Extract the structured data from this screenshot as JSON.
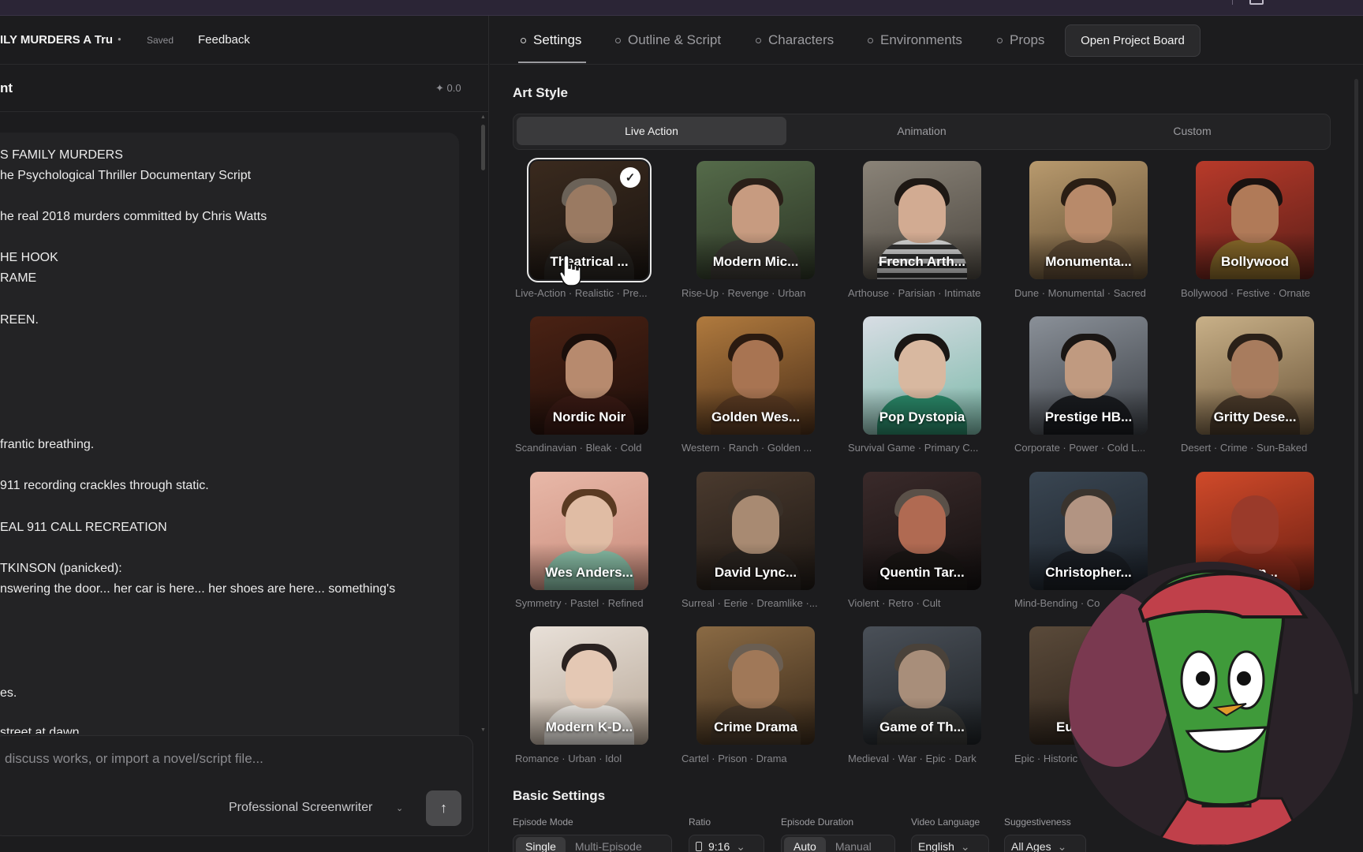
{
  "project": {
    "title": "ILY MURDERS A Tru",
    "save_status": "Saved",
    "feedback_label": "Feedback"
  },
  "document": {
    "title": "nt",
    "credits": "✦ 0.0",
    "lines": [
      "S FAMILY MURDERS",
      "he Psychological Thriller Documentary Script",
      "he real 2018 murders committed by Chris Watts",
      "HE HOOK",
      "RAME",
      "REEN.",
      "frantic breathing.",
      " 911 recording crackles through static.",
      "EAL 911 CALL RECREATION",
      "TKINSON (panicked):",
      "nswering the door... her car is here... her shoes are here... something's",
      "es.",
      " street at dawn"
    ]
  },
  "chat": {
    "placeholder": " discuss works, or import a novel/script file...",
    "persona": "Professional Screenwriter",
    "send_icon": "arrow-up-icon"
  },
  "tabs": [
    {
      "label": "Settings",
      "active": true
    },
    {
      "label": "Outline & Script",
      "active": false
    },
    {
      "label": "Characters",
      "active": false
    },
    {
      "label": "Environments",
      "active": false
    },
    {
      "label": "Props",
      "active": false
    }
  ],
  "open_board_label": "Open Project Board",
  "art_style": {
    "title": "Art Style",
    "segments": [
      "Live Action",
      "Animation",
      "Custom"
    ],
    "active_segment": "Live Action",
    "cards": [
      {
        "name": "Theatrical ...",
        "tags": "Live-Action · Realistic · Pre...",
        "selected": true
      },
      {
        "name": "Modern Mic...",
        "tags": "Rise-Up · Revenge · Urban"
      },
      {
        "name": "French Arth...",
        "tags": "Arthouse · Parisian · Intimate"
      },
      {
        "name": "Monumenta...",
        "tags": "Dune · Monumental · Sacred"
      },
      {
        "name": "Bollywood",
        "tags": "Bollywood · Festive · Ornate"
      },
      {
        "name": "Nordic Noir",
        "tags": "Scandinavian · Bleak · Cold"
      },
      {
        "name": "Golden Wes...",
        "tags": "Western · Ranch · Golden ..."
      },
      {
        "name": "Pop Dystopia",
        "tags": "Survival Game · Primary C..."
      },
      {
        "name": "Prestige HB...",
        "tags": "Corporate · Power · Cold L..."
      },
      {
        "name": "Gritty Dese...",
        "tags": "Desert · Crime · Sun-Baked"
      },
      {
        "name": "Wes Anders...",
        "tags": "Symmetry · Pastel · Refined"
      },
      {
        "name": "David Lync...",
        "tags": "Surreal · Eerie · Dreamlike ·..."
      },
      {
        "name": "Quentin Tar...",
        "tags": "Violent · Retro · Cult"
      },
      {
        "name": "Christopher...",
        "tags": "Mind-Bending · Co"
      },
      {
        "name": "Runn...",
        "tags": ""
      },
      {
        "name": "Modern K-D...",
        "tags": "Romance · Urban · Idol"
      },
      {
        "name": "Crime Drama",
        "tags": "Cartel · Prison · Drama"
      },
      {
        "name": "Game of Th...",
        "tags": "Medieval · War · Epic · Dark"
      },
      {
        "name": "Euro",
        "tags": "Epic · Historic"
      }
    ],
    "selected_badge": "✓"
  },
  "basic_settings": {
    "title": "Basic Settings",
    "episode_mode": {
      "label": "Episode Mode",
      "options": [
        "Single",
        "Multi-Episode"
      ],
      "active": "Single"
    },
    "ratio": {
      "label": "Ratio",
      "value": "9:16"
    },
    "episode_duration": {
      "label": "Episode Duration",
      "options": [
        "Auto",
        "Manual"
      ],
      "active": "Auto"
    },
    "video_language": {
      "label": "Video Language",
      "value": "English"
    },
    "suggestiveness": {
      "label": "Suggestiveness",
      "value": "All Ages"
    }
  },
  "colors": {
    "background": "#1c1c1e",
    "panel": "#232325",
    "accent_active": "#3a3a3c",
    "text_primary": "#f2f2f2",
    "text_muted": "#86868a"
  }
}
